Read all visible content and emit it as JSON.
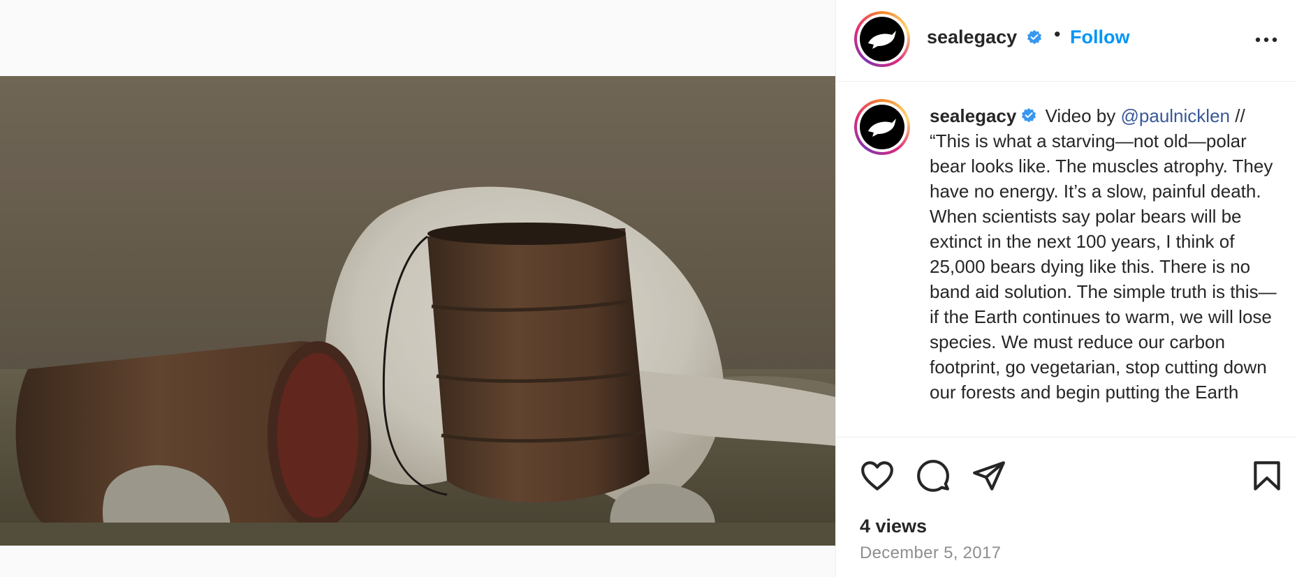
{
  "post": {
    "username": "sealegacy",
    "follow_label": "Follow",
    "separator": "•",
    "caption_user": "sealegacy",
    "caption_prefix": " Video by ",
    "caption_mention": "@paulnicklen",
    "caption_body": "// “This is what a starving—not old—polar bear looks like. The muscles atrophy. They have no energy. It’s a slow, painful death. When scientists say polar bears will be extinct in the next 100 years, I think of 25,000 bears dying like this. There is no band aid solution. The simple truth is this—if the Earth continues to warm, we will lose species. We must reduce our carbon footprint, go vegetarian, stop cutting down our forests and begin putting the Earth",
    "views": "4 views",
    "date": "December 5, 2017"
  },
  "icons": {
    "verified": "verified-badge-icon",
    "more": "more-options-icon",
    "like": "heart-icon",
    "comment": "comment-icon",
    "share": "paper-plane-icon",
    "save": "bookmark-icon",
    "mute": "muted-speaker-icon"
  },
  "colors": {
    "follow": "#0095f6",
    "mention": "#385898",
    "verified": "#3897f0",
    "date": "#8e8e8e"
  }
}
